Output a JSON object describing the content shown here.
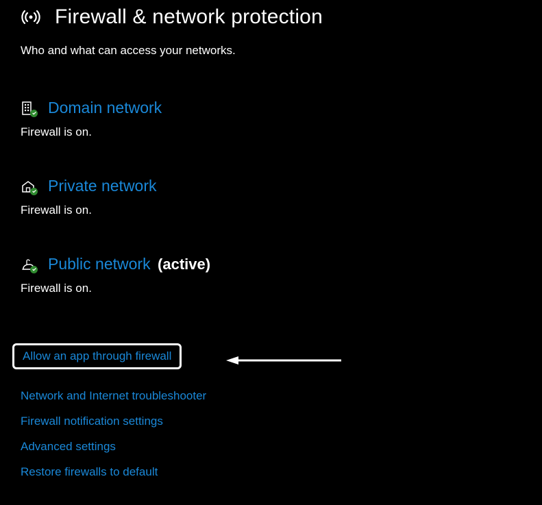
{
  "header": {
    "title": "Firewall & network protection",
    "subtitle": "Who and what can access your networks."
  },
  "networks": {
    "domain": {
      "label": "Domain network",
      "status": "Firewall is on."
    },
    "private": {
      "label": "Private network",
      "status": "Firewall is on."
    },
    "public": {
      "label": "Public network",
      "active_badge": "(active)",
      "status": "Firewall is on."
    }
  },
  "links": {
    "allow_app": "Allow an app through firewall",
    "troubleshooter": "Network and Internet troubleshooter",
    "notifications": "Firewall notification settings",
    "advanced": "Advanced settings",
    "restore": "Restore firewalls to default"
  },
  "colors": {
    "link": "#1a88d8",
    "background": "#000000",
    "text": "#ffffff",
    "checkmark": "#2f8a2f"
  }
}
